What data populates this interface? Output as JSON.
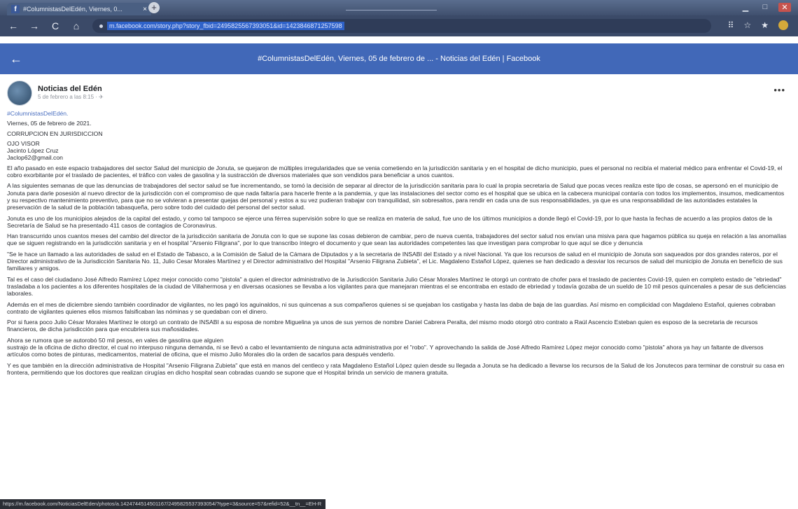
{
  "browser": {
    "tab_title": "#ColumnistasDelEdén, Viernes, 0...",
    "tab_close": "×",
    "new_tab": "+",
    "url": "m.facebook.com/story.php?story_fbid=2495825567393051&id=1423846871257598",
    "window_controls": {
      "minimize": "▁",
      "maximize": "□",
      "close": "✕"
    },
    "nav": {
      "back": "←",
      "forward": "→",
      "reload": "C",
      "home": "⌂"
    },
    "toolbar_icons": {
      "grid": "⠿",
      "star": "☆",
      "ext": "★"
    },
    "status_url": "https://m.facebook.com/NoticiasDelEden/photos/a.1424744514501167/2495825537393054/?type=3&source=57&refid=52&__tn__=EH-R"
  },
  "fbheader": {
    "back": "←",
    "title": "#ColumnistasDelEdén, Viernes, 05 de febrero de ... - Noticias del Edén | Facebook"
  },
  "post": {
    "author": "Noticias del Edén",
    "time": "5 de febrero a las 8:15 · ✈",
    "more": "•••",
    "hashtag": "#ColumnistasDelEdén.",
    "header_lines": [
      "Viernes, 05 de febrero de 2021.",
      "CORRUPCION EN JURISDICCION",
      "OJO VISOR",
      "Jacinto López Cruz",
      "Jaclop62@gmail.con"
    ],
    "paragraphs": [
      "El año pasado en este espacio trabajadores del sector Salud del municipio de Jonuta, se quejaron de múltiples irregularidades que se venia cometiendo en la jurisdicción sanitaria y en el hospital de dicho municipio, pues el personal no recibía el material médico para enfrentar el Covid-19, el cobro exorbitante por el traslado de pacientes, el tráfico con vales de gasolina y la sustracción de diversos materiales que son vendidos para beneficiar a unos cuantos.",
      "A las siguientes semanas de que las denuncias de trabajadores del sector salud se fue incrementando, se tomó la decisión de separar al director de la jurisdicción sanitaria para lo cual la propia secretaria de Salud que pocas veces realiza este tipo de cosas, se apersonó en el municipio de Jonuta para darle posesión al nuevo director de la jurisdicción con el compromiso de que nada faltaría para hacerle frente a la pandemia, y que las instalaciones del sector como es el hospital que se ubica en la cabecera municipal contaría con todos los implementos, insumos, medicamentos y su respectivo mantenimiento preventivo, para que no se volvieran a presentar quejas del personal y estos a su vez pudieran trabajar con tranquilidad, sin sobresaltos, para rendir en cada una de sus responsabilidades, ya que es una responsabilidad de las autoridades estatales la preservación de la salud de la población tabasqueña, pero sobre todo del cuidado del personal del sector salud.",
      "Jonuta es uno de los municipios alejados de la capital del estado, y como tal tampoco se ejerce una férrea supervisión sobre lo que se realiza en materia de salud, fue uno de los últimos municipios a donde llegó el Covid-19, por lo que hasta la fechas de acuerdo a las propios datos de la Secretaría de Salud se ha presentado 411 casos de contagios de Coronavirus.",
      "Han transcurrido unos cuantos meses del cambio del director de la jurisdicción sanitaria de Jonuta con lo que se supone las cosas debieron de cambiar, pero de nueva cuenta, trabajadores del sector salud nos envían una misiva para que hagamos pública su queja en relación a las anomalías que se siguen registrando en la jurisdicción sanitaria y en el hospital \"Arsenio Filigrana\", por lo que transcribo íntegro el documento y que sean las autoridades competentes las que investigan para comprobar lo que aquí se dice y denuncia",
      "\"Se le hace un llamado a las autoridades de salud en el Estado de Tabasco, a la Comisión de Salud de la Cámara de Diputados y a la secretaria de INSABI del Estado y a nivel Nacional. Ya que los recursos de salud en el municipio de Jonuta son saqueados por dos grandes rateros, por el Director administrativo de la Jurisdicción Sanitaria No. 11, Julio Cesar Morales Martínez y el Director administrativo del Hospital \"Arsenio Filigrana Zubieta\", el Lic. Magdaleno Estañol López, quienes se han dedicado a desviar los recursos de salud del municipio de Jonuta en beneficio de sus familiares y amigos.",
      "Tal es el caso del ciudadano José Alfredo Ramírez López mejor conocido como \"pistola\" a quien el director administrativo de la Jurisdicción Sanitaria Julio César Morales Martínez le otorgó un contrato de chofer para el traslado de pacientes Covid-19, quien en completo estado de \"ebriedad\" trasladaba a los pacientes a los diferentes hospitales de la ciudad de Villahermosa y en diversas ocasiones se llevaba a los vigilantes para que manejaran mientras el se encontraba en estado de ebriedad y todavía gozaba de un sueldo de 10 mil pesos quincenales a pesar de sus deficiencias laborales.",
      "Además en el mes de diciembre siendo también coordinador de vigilantes, no les pagó los aguinaldos, ni sus quincenas a sus compañeros quienes si se quejaban los castigaba y hasta las daba de baja de las guardias. Así mismo en complicidad con Magdaleno Estañol, quienes cobraban contrato de vigilantes quienes ellos mismos falsificaban las nóminas y se quedaban con el dinero.",
      "Por si fuera poco Julio César Morales Martínez le otorgó un contrato de INSABI a su esposa de nombre Miguelina ya unos de sus yernos de nombre Daniel Cabrera Peralta, del mismo modo otorgó otro contrato a Raúl Ascencio Esteban quien es esposo de la secretaria de recursos financieros, de dicha jurisdicción para que encubriera sus mañosidades.",
      "Ahora se rumora que se autorobó 50 mil pesos, en vales de gasolina que alguien\nsustrajo de la oficina de dicho director, el cual no interpuso ninguna demanda, ni se llevó a cabo el levantamiento de ninguna acta administrativa por el \"robo\". Y aprovechando la salida de José Alfredo Ramírez López mejor conocido como \"pistola\" ahora ya hay un faltante de diversos artículos como botes de pinturas, medicamentos, material de oficina, que el mismo Julio Morales dio la orden de sacarlos para después venderlo.",
      "Y es que también en la dirección administrativa de Hospital \"Arsenio Filigrana Zubieta\" que está en manos del centleco y rata Magdaleno Estañol López quien desde su llegada a Jonuta se ha dedicado a llevarse los recursos de la Salud de los Jonutecos para terminar de construir su casa en frontera, permitiendo que los doctores que realizan cirugías en dicho hospital sean cobradas cuando se supone que el Hospital brinda un servicio de manera gratuita."
    ]
  }
}
